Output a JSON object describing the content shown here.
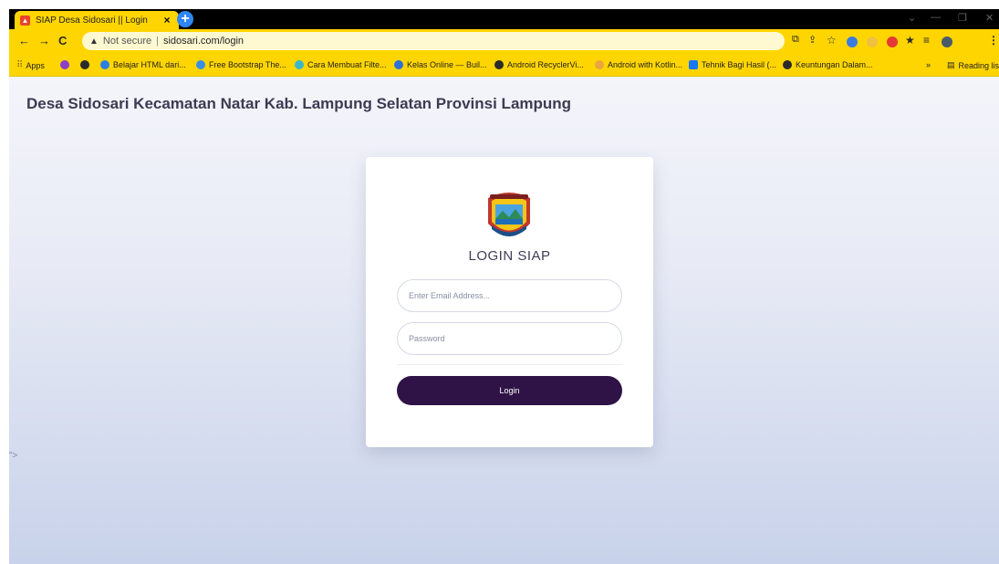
{
  "browser": {
    "tab_title": "SIAP Desa Sidosari || Login",
    "tab_favicon": "app-favicon",
    "not_secure_label": "Not secure",
    "url": "sidosari.com/login",
    "reading_list_label": "Reading list",
    "bookmarks": [
      {
        "label": "Apps",
        "icon": "apps-grid-icon",
        "color": "#8a6d00"
      },
      {
        "label": "",
        "icon": "bookmark-icon-1",
        "color": "#8b3fc7"
      },
      {
        "label": "",
        "icon": "bookmark-icon-2",
        "color": "#2b2b2b"
      },
      {
        "label": "Belajar HTML dari...",
        "icon": "bookmark-icon-3",
        "color": "#2a7de1"
      },
      {
        "label": "Free Bootstrap The...",
        "icon": "bookmark-icon-4",
        "color": "#3a8ee6"
      },
      {
        "label": "Cara Membuat Filte...",
        "icon": "bookmark-icon-5",
        "color": "#39b8c9"
      },
      {
        "label": "Kelas Online — Buil...",
        "icon": "bookmark-icon-6",
        "color": "#2f6fd6"
      },
      {
        "label": "Android RecyclerVi...",
        "icon": "bookmark-icon-7",
        "color": "#2b2b2b"
      },
      {
        "label": "Android with Kotlin...",
        "icon": "bookmark-icon-8",
        "color": "#e8a640"
      },
      {
        "label": "Tehnik Bagi Hasil (...",
        "icon": "facebook-icon",
        "color": "#1877f2"
      },
      {
        "label": "Keuntungan Dalam...",
        "icon": "bookmark-icon-9",
        "color": "#2b2b2b"
      }
    ]
  },
  "page": {
    "site_title": "Desa Sidosari Kecamatan Natar Kab. Lampung Selatan Provinsi Lampung",
    "stray_text": "\">",
    "login": {
      "logo": "village-emblem-logo",
      "title": "LOGIN SIAP",
      "email_placeholder": "Enter Email Address...",
      "password_placeholder": "Password",
      "button_label": "Login"
    }
  },
  "colors": {
    "browser_accent": "#ffd500",
    "button": "#2f1346",
    "title_text": "#3d3b52"
  }
}
